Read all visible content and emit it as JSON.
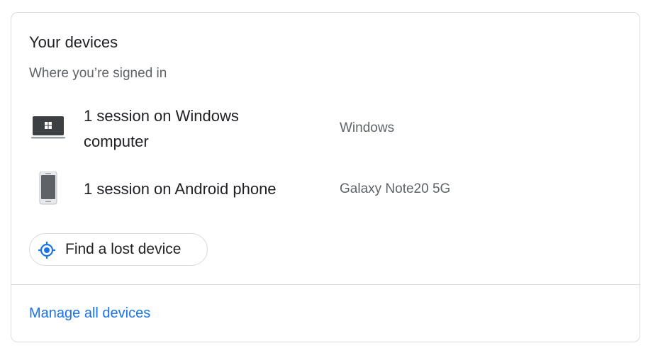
{
  "card": {
    "title": "Your devices",
    "subtitle": "Where you’re signed in"
  },
  "devices": [
    {
      "name": "1 session on Windows computer",
      "model": "Windows",
      "icon": "windows-laptop-icon"
    },
    {
      "name": "1 session on Android phone",
      "model": "Galaxy Note20 5G",
      "icon": "android-phone-icon"
    }
  ],
  "find_device": {
    "label": "Find a lost device",
    "icon": "locate-target-icon"
  },
  "manage": {
    "label": "Manage all devices"
  },
  "colors": {
    "link": "#1a73e8",
    "primary_text": "#202124",
    "secondary_text": "#5f6368",
    "border": "#dadce0"
  }
}
